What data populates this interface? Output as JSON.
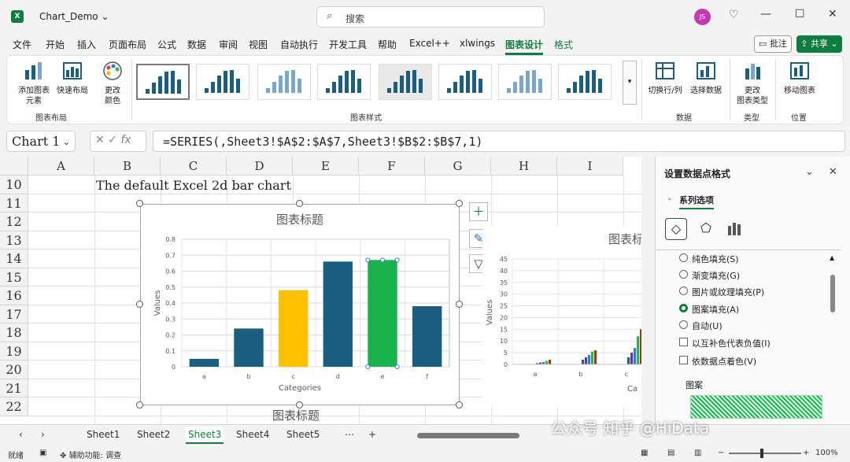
{
  "window": {
    "filename": "Chart_Demo",
    "search_placeholder": "搜索",
    "avatar_initials": "JS"
  },
  "menu": {
    "tabs": [
      "文件",
      "开始",
      "插入",
      "页面布局",
      "公式",
      "数据",
      "审阅",
      "视图",
      "自动执行",
      "开发工具",
      "帮助",
      "Excel++",
      "xlwings",
      "图表设计",
      "格式"
    ],
    "active_tab": "图表设计",
    "comment": "批注",
    "share": "共享"
  },
  "ribbon": {
    "add_element": "添加图表\n元素",
    "quick_layout": "快速布局",
    "change_colors": "更改\n颜色",
    "group_layout": "图表布局",
    "group_styles": "图表样式",
    "switch_row_col": "切换行/列",
    "select_data": "选择数据",
    "group_data": "数据",
    "change_type": "更改\n图表类型",
    "group_type": "类型",
    "move_chart": "移动图表",
    "group_location": "位置"
  },
  "formula_bar": {
    "name_box": "Chart 1",
    "fx": "fx",
    "formula": "=SERIES(,Sheet3!$A$2:$A$7,Sheet3!$B$2:$B$7,1)"
  },
  "grid": {
    "columns": [
      "A",
      "B",
      "C",
      "D",
      "E",
      "F",
      "G",
      "H",
      "I"
    ],
    "rows": [
      "10",
      "11",
      "12",
      "13",
      "14",
      "15",
      "16",
      "17",
      "18",
      "19",
      "20",
      "21",
      "22"
    ],
    "cell_b10": "The default Excel 2d bar chart"
  },
  "chart_data": [
    {
      "type": "bar",
      "title": "图表标题",
      "categories": [
        "a",
        "b",
        "c",
        "d",
        "e",
        "f"
      ],
      "values": [
        0.05,
        0.24,
        0.48,
        0.66,
        0.67,
        0.38
      ],
      "bar_colors": [
        "#1b5e80",
        "#1b5e80",
        "#ffc000",
        "#1b5e80",
        "#19b24b",
        "#1b5e80"
      ],
      "xlabel": "Categories",
      "ylabel": "Values",
      "ylim": [
        0,
        0.8
      ],
      "yticks": [
        "0",
        "0.1",
        "0.2",
        "0.3",
        "0.4",
        "0.5",
        "0.6",
        "0.7",
        "0.8"
      ]
    },
    {
      "type": "bar",
      "title": "图表标",
      "categories": [
        "a",
        "b",
        "c"
      ],
      "ylabel": "Values",
      "xlabel": "Ca",
      "ylim": [
        0,
        45
      ],
      "yticks": [
        "0",
        "5",
        "10",
        "15",
        "20",
        "25",
        "30",
        "35",
        "40",
        "45"
      ],
      "series": [
        {
          "values": [
            0.5,
            2,
            3
          ]
        },
        {
          "values": [
            0.8,
            3,
            5
          ]
        },
        {
          "values": [
            1,
            4,
            7
          ]
        },
        {
          "values": [
            1.5,
            5.5,
            12
          ]
        },
        {
          "values": [
            2,
            6,
            15
          ]
        }
      ]
    }
  ],
  "third_chart_title": "图表标题",
  "pane": {
    "title": "设置数据点格式",
    "section": "系列选项",
    "options": [
      {
        "label": "纯色填充(S)",
        "kind": "radio",
        "on": false
      },
      {
        "label": "渐变填充(G)",
        "kind": "radio",
        "on": false
      },
      {
        "label": "图片或纹理填充(P)",
        "kind": "radio",
        "on": false
      },
      {
        "label": "图案填充(A)",
        "kind": "radio",
        "on": true
      },
      {
        "label": "自动(U)",
        "kind": "radio",
        "on": false
      },
      {
        "label": "以互补色代表负值(I)",
        "kind": "check",
        "on": false
      },
      {
        "label": "依数据点着色(V)",
        "kind": "check",
        "on": false
      }
    ],
    "pattern_label": "图案"
  },
  "sheets": {
    "tabs": [
      "Sheet1",
      "Sheet2",
      "Sheet3",
      "Sheet4",
      "Sheet5"
    ],
    "active": "Sheet3"
  },
  "status": {
    "ready": "就绪",
    "accessibility": "辅助功能: 调查",
    "zoom": "100%"
  },
  "watermark": "公众号 知乎 @HiData"
}
